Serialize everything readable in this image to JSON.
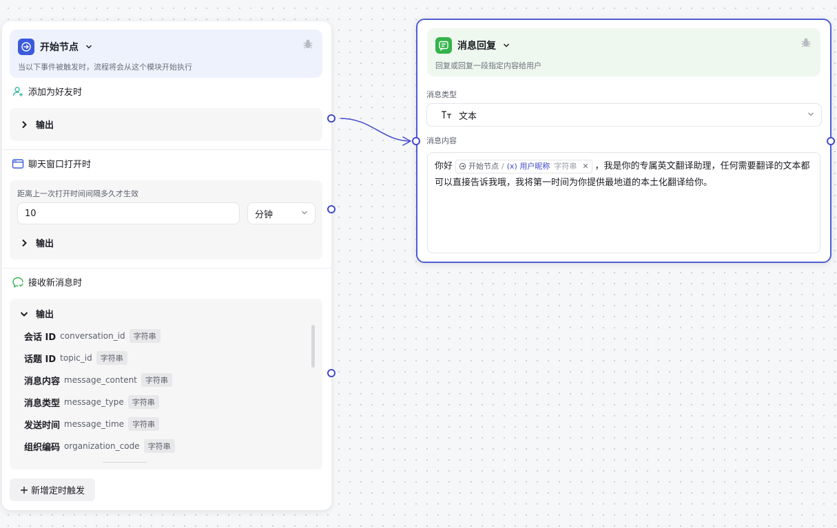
{
  "start_node": {
    "title": "开始节点",
    "description": "当以下事件被触发时，流程将会从这个模块开始执行",
    "triggers": {
      "add_friend": {
        "label": "添加为好友时",
        "output_label": "输出"
      },
      "chat_window": {
        "label": "聊天窗口打开时",
        "interval_label": "距离上一次打开时间间隔多久才生效",
        "interval_value": "10",
        "unit_value": "分钟",
        "output_label": "输出"
      },
      "new_message": {
        "label": "接收新消息时",
        "output_label": "输出",
        "params": [
          {
            "name": "会话 ID",
            "key": "conversation_id",
            "type": "字符串"
          },
          {
            "name": "话题 ID",
            "key": "topic_id",
            "type": "字符串"
          },
          {
            "name": "消息内容",
            "key": "message_content",
            "type": "字符串"
          },
          {
            "name": "消息类型",
            "key": "message_type",
            "type": "字符串"
          },
          {
            "name": "发送时间",
            "key": "message_time",
            "type": "字符串"
          },
          {
            "name": "组织编码",
            "key": "organization_code",
            "type": "字符串"
          }
        ]
      }
    },
    "add_trigger_label": "新增定时触发"
  },
  "reply_node": {
    "title": "消息回复",
    "description": "回复或回复一段指定内容给用户",
    "message_type_label": "消息类型",
    "message_type_value": "文本",
    "message_content_label": "消息内容",
    "content": {
      "prefix": "你好",
      "chip_node": "开始节点",
      "chip_sep": "/",
      "chip_var": "用户昵称",
      "chip_type": "字符串",
      "text": "，我是你的专属英文翻译助理，任何需要翻译的文本都可以直接告诉我哦，我将第一时间为你提供最地道的本土化翻译给你。"
    }
  },
  "colors": {
    "accent": "#4149c9",
    "start_header_bg": "#eef2fd",
    "reply_header_bg": "#eef8ef",
    "selected_border": "#4f5bd5"
  }
}
